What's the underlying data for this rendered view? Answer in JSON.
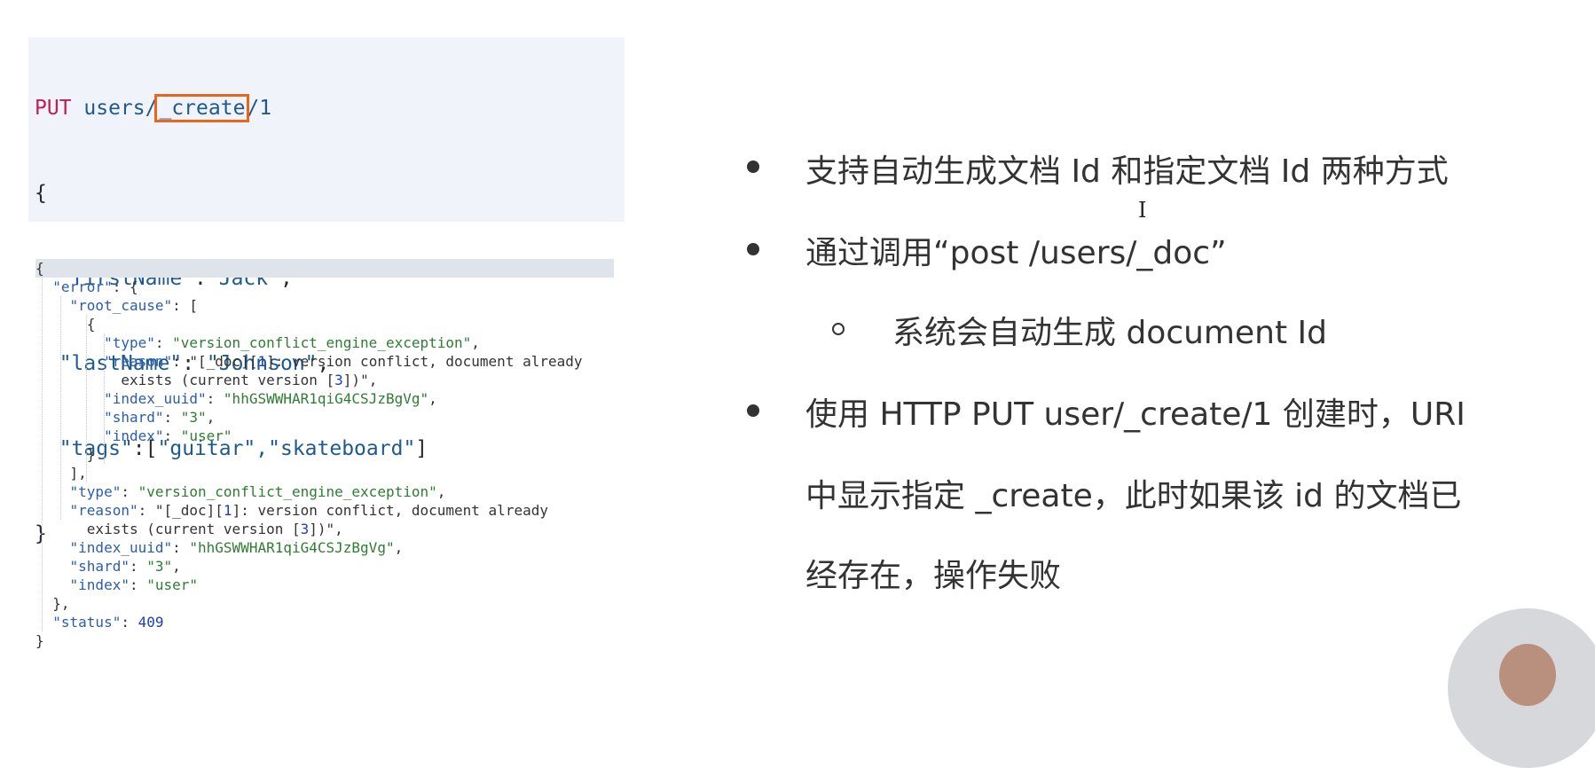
{
  "request": {
    "line1": {
      "method": "PUT",
      "path_a": " users/",
      "path_b": "_create",
      "path_c": "/1"
    },
    "brace_open": "{",
    "brace_close": "}",
    "fields": [
      {
        "key": "\"firstName\"",
        "sep": ":",
        "value": "\"Jack\"",
        "end": ","
      },
      {
        "key": "\"lastName\"",
        "sep": ": ",
        "value": "\"Johnson\"",
        "end": ","
      },
      {
        "key": "\"tags\"",
        "sep": ":[",
        "value": "\"guitar\",\"skateboard\"",
        "end": "]"
      }
    ]
  },
  "response": {
    "lines": [
      "{",
      "  \"error\": {",
      "    \"root_cause\": [",
      "      {",
      "        \"type\": \"version_conflict_engine_exception\",",
      "        \"reason\": \"[_doc][1]: version conflict, document already",
      "          exists (current version [3])\",",
      "        \"index_uuid\": \"hhGSWWHAR1qiG4CSJzBgVg\",",
      "        \"shard\": \"3\",",
      "        \"index\": \"user\"",
      "      }",
      "    ],",
      "    \"type\": \"version_conflict_engine_exception\",",
      "    \"reason\": \"[_doc][1]: version conflict, document already",
      "      exists (current version [3])\",",
      "    \"index_uuid\": \"hhGSWWHAR1qiG4CSJzBgVg\",",
      "    \"shard\": \"3\",",
      "    \"index\": \"user\"",
      "  },",
      "  \"status\": 409",
      "}"
    ]
  },
  "bullets": [
    {
      "type": "dot",
      "text": "支持自动生成文档 Id 和指定文档 Id 两种方式"
    },
    {
      "type": "dot",
      "text": "通过调用“post /users/_doc”"
    },
    {
      "type": "ring",
      "text": "系统会自动生成 document Id"
    },
    {
      "type": "dot",
      "text": "使用 HTTP PUT  user/_create/1 创建时，URI"
    },
    {
      "type": "cont",
      "text": "中显示指定 _create，此时如果该 id 的文档已"
    },
    {
      "type": "cont",
      "text": "经存在，操作失败"
    }
  ],
  "colors": {
    "highlight": "#e8661c",
    "code_bg": "#f0f3fa",
    "key": "#1f5a8f",
    "method": "#c21e50"
  }
}
